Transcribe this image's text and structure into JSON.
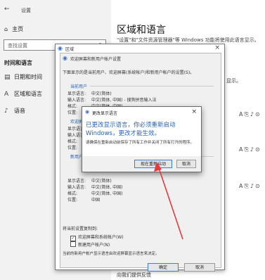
{
  "settings": {
    "window_title": "设置",
    "home_label": "主页",
    "search_placeholder": "查找设置",
    "section_title": "时间和语言",
    "nav": [
      {
        "label": "日期和时间"
      },
      {
        "label": "区域和语言"
      },
      {
        "label": "语音"
      }
    ],
    "main_title": "区域和语言",
    "main_desc": "\"设置\"和\"文件资源管理器\"等 Windows 功能将使用此语言显示。",
    "right_cut_text": "显示。",
    "feedback": "向我们提供反馈"
  },
  "welcome_dialog": {
    "outer_title": "区域",
    "inner_title": "欢迎屏幕和新用户帐户设置",
    "description": "下面显示的是当前用户、欢迎屏幕(系统帐户)和新用户帐户的设置(S)。",
    "groups": [
      {
        "label": "当前用户",
        "rows": [
          {
            "k": "显示语言:",
            "v": "中文(简体)"
          },
          {
            "k": "输入语言:",
            "v": "中文(简体, 中国) - 搜狗拼音输入法"
          },
          {
            "k": "格式:",
            "v": "中文(简体, 中国)"
          },
          {
            "k": "位置:",
            "v": "中国"
          }
        ]
      },
      {
        "label": "欢迎屏幕",
        "rows": [
          {
            "k": "显示语言:",
            "v": ""
          },
          {
            "k": "输入语言:",
            "v": ""
          },
          {
            "k": "格式:",
            "v": ""
          },
          {
            "k": "位置:",
            "v": ""
          }
        ]
      },
      {
        "label": "新用户帐户",
        "rows": [
          {
            "k": "显示语言:",
            "v": "中文(简体)"
          },
          {
            "k": "输入语言:",
            "v": "中文(简体, 中国)"
          },
          {
            "k": "格式:",
            "v": "中文(简体, 中国)"
          },
          {
            "k": "位置:",
            "v": "中国"
          }
        ]
      }
    ],
    "copy_label": "将当前设置复制到:",
    "checkboxes": [
      {
        "label": "欢迎屏幕和系统帐户(W)",
        "checked": true
      },
      {
        "label": "新建用户帐户(N)",
        "checked": false
      }
    ],
    "note": "当前的新用户帐户显示语言由欢迎屏幕显示语言来决定。",
    "ok_label": "确定",
    "cancel_label": "取消"
  },
  "change_dialog": {
    "title": "更改显示语言",
    "main_text": "已更改显示语言，你必须重新启动 Windows，更改才能生效。",
    "sub_text": "请确保在重新启动前保存了所有工作并关闭了所有打开的程序。",
    "restart_label": "现在重新启动",
    "cancel_label": "取消"
  },
  "colors": {
    "accent_blue": "#2a63b5",
    "arrow_red": "#e23b3b"
  }
}
